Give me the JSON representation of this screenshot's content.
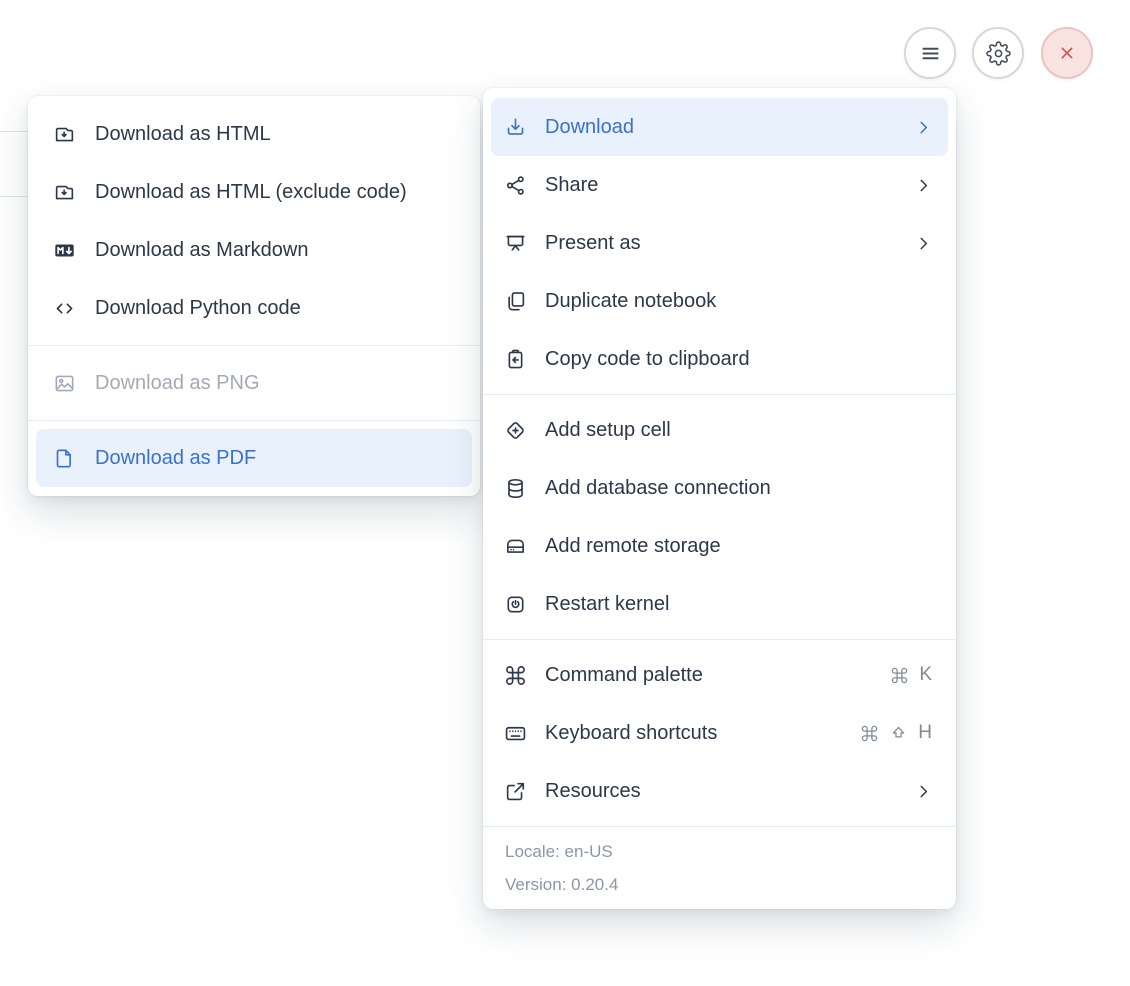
{
  "topbar": {
    "buttons": [
      {
        "id": "menu",
        "icon": "hamburger-icon"
      },
      {
        "id": "settings",
        "icon": "gear-icon"
      },
      {
        "id": "close",
        "icon": "close-icon"
      }
    ]
  },
  "main_menu": {
    "sections": [
      {
        "items": [
          {
            "label": "Download",
            "icon": "download-tray-icon",
            "active": true,
            "chevron": true
          },
          {
            "label": "Share",
            "icon": "share-icon",
            "chevron": true
          },
          {
            "label": "Present as",
            "icon": "present-icon",
            "chevron": true
          },
          {
            "label": "Duplicate notebook",
            "icon": "duplicate-icon"
          },
          {
            "label": "Copy code to clipboard",
            "icon": "clipboard-arrow-icon"
          }
        ]
      },
      {
        "items": [
          {
            "label": "Add setup cell",
            "icon": "add-cell-icon"
          },
          {
            "label": "Add database connection",
            "icon": "database-icon"
          },
          {
            "label": "Add remote storage",
            "icon": "remote-storage-icon"
          },
          {
            "label": "Restart kernel",
            "icon": "restart-kernel-icon"
          }
        ]
      },
      {
        "items": [
          {
            "label": "Command palette",
            "icon": "command-icon",
            "shortcut": [
              "cmd",
              "K"
            ]
          },
          {
            "label": "Keyboard shortcuts",
            "icon": "keyboard-icon",
            "shortcut": [
              "cmd",
              "shift",
              "H"
            ]
          },
          {
            "label": "Resources",
            "icon": "external-link-icon",
            "chevron": true
          }
        ]
      }
    ],
    "footer": {
      "locale": "Locale: en-US",
      "version": "Version: 0.20.4"
    }
  },
  "download_submenu": {
    "sections": [
      {
        "items": [
          {
            "label": "Download as HTML",
            "icon": "folder-download-icon"
          },
          {
            "label": "Download as HTML (exclude code)",
            "icon": "folder-download-icon"
          },
          {
            "label": "Download as Markdown",
            "icon": "markdown-icon"
          },
          {
            "label": "Download Python code",
            "icon": "code-icon"
          }
        ]
      },
      {
        "items": [
          {
            "label": "Download as PNG",
            "icon": "image-icon",
            "disabled": true
          }
        ]
      },
      {
        "items": [
          {
            "label": "Download as PDF",
            "icon": "file-icon",
            "active": true
          }
        ]
      }
    ]
  },
  "colors": {
    "accent_blue": "#3a70cf",
    "active_background": "#e9f1fc",
    "text_dark": "#2c374a",
    "text_disabled": "#a2aab6",
    "text_muted": "#8b96a8",
    "shortcut_gray": "#7f8999",
    "divider": "#e7eaee",
    "close_red": "#d85050",
    "close_background": "#f9e3e1"
  }
}
